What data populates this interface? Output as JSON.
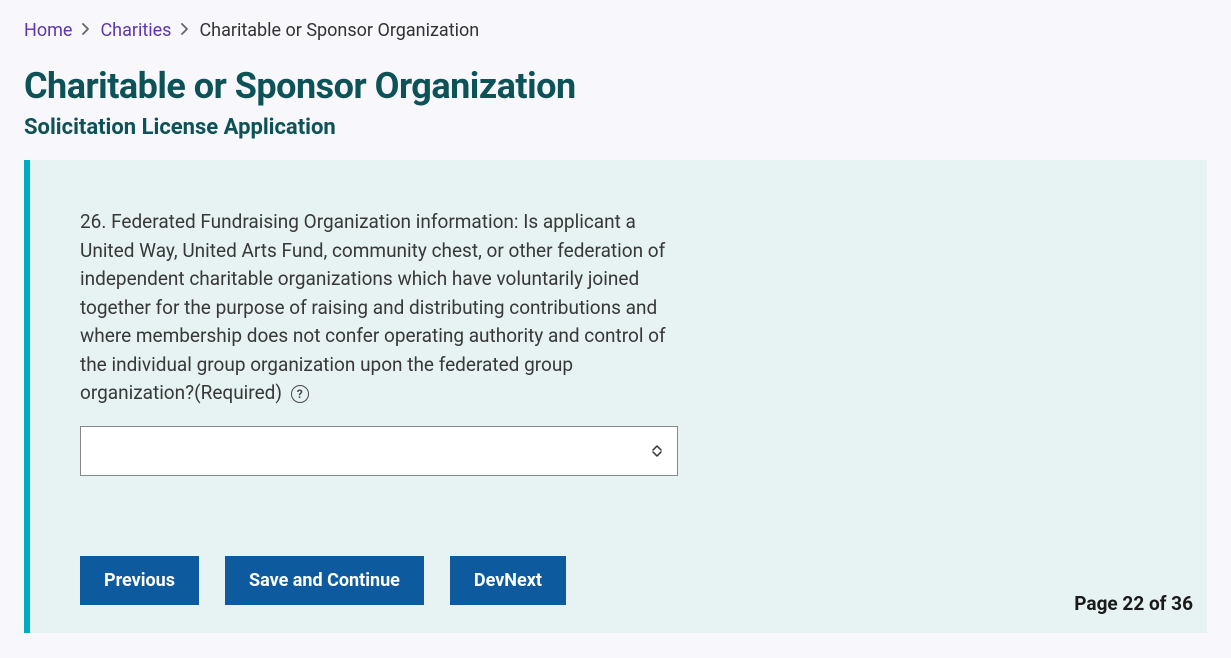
{
  "breadcrumb": {
    "home": "Home",
    "charities": "Charities",
    "current": "Charitable or Sponsor Organization"
  },
  "page": {
    "title": "Charitable or Sponsor Organization",
    "subtitle": "Solicitation License Application"
  },
  "form": {
    "question_text": "26. Federated Fundraising Organization information: Is applicant a United Way, United Arts Fund, community chest, or other federation of independent charitable organizations which have voluntarily joined together for the purpose of raising and distributing contributions and where membership does not confer operating authority and control of the individual group organization upon the federated group organization?",
    "required_text": "(Required)",
    "select_value": ""
  },
  "buttons": {
    "previous": "Previous",
    "save_continue": "Save and Continue",
    "dev_next": "DevNext"
  },
  "pagination": {
    "text": "Page 22 of 36"
  }
}
